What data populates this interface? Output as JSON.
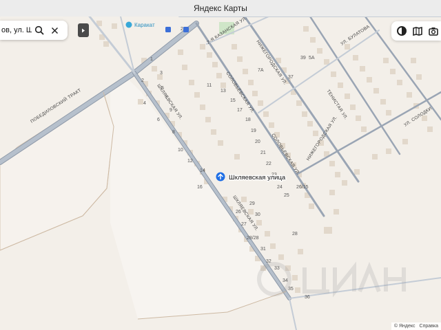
{
  "window": {
    "title": "Яндекс Карты"
  },
  "search": {
    "query": "ов, ул. Шкл"
  },
  "place": {
    "label": "Шкляевская улица"
  },
  "poi": {
    "name": "Каракат"
  },
  "streets": {
    "pobedilovsky": "ПОБЕДИЛОВСКИЙ ТРАКТ",
    "shklyaevskaya": "ШКЛЯЕВСКАЯ УЛ.",
    "shklyaevskaya_lower": "ШКЛЯЕВСКАЯ УЛ.",
    "solovyevskaya": "СОЛОВЬЁВСКАЯ УЛ.",
    "solovyevskaya_lower": "СОЛОВЬЁВСКАЯ УЛ.",
    "kazanskaya": "2-Я КАЗАНСКАЯ УЛ.",
    "nizhegorodskaya": "НИЖЕГОРОДСКАЯ УЛ.",
    "nizhegorodskaya_lower": "НИЖЕГОРОДСКАЯ УЛ.",
    "tenistaya": "ТЕНИСТАЯ УЛ.",
    "bulatova": "УЛ. БУЛАТОВА",
    "solodki": "УЛ. СОЛОДКИ"
  },
  "house_numbers": [
    "1",
    "2",
    "2",
    "3",
    "4",
    "5",
    "6",
    "7",
    "8",
    "9",
    "10",
    "11",
    "12",
    "13",
    "14",
    "15",
    "16",
    "17",
    "18",
    "19",
    "20",
    "21",
    "22",
    "23",
    "24",
    "25",
    "26",
    "26/15",
    "27",
    "28",
    "28/28",
    "29",
    "30",
    "31",
    "32",
    "33",
    "34",
    "35",
    "36",
    "37",
    "39",
    "5А",
    "7А",
    "8"
  ],
  "footer": {
    "copyright": "© Яндекс",
    "help": "Справка"
  },
  "colors": {
    "road": "#aab4c2",
    "roadEdge": "#8e99a8",
    "background": "#f3efe9",
    "field": "#f6f2ed",
    "building": "#e2d8cb",
    "pin": "#1f6fe5"
  }
}
